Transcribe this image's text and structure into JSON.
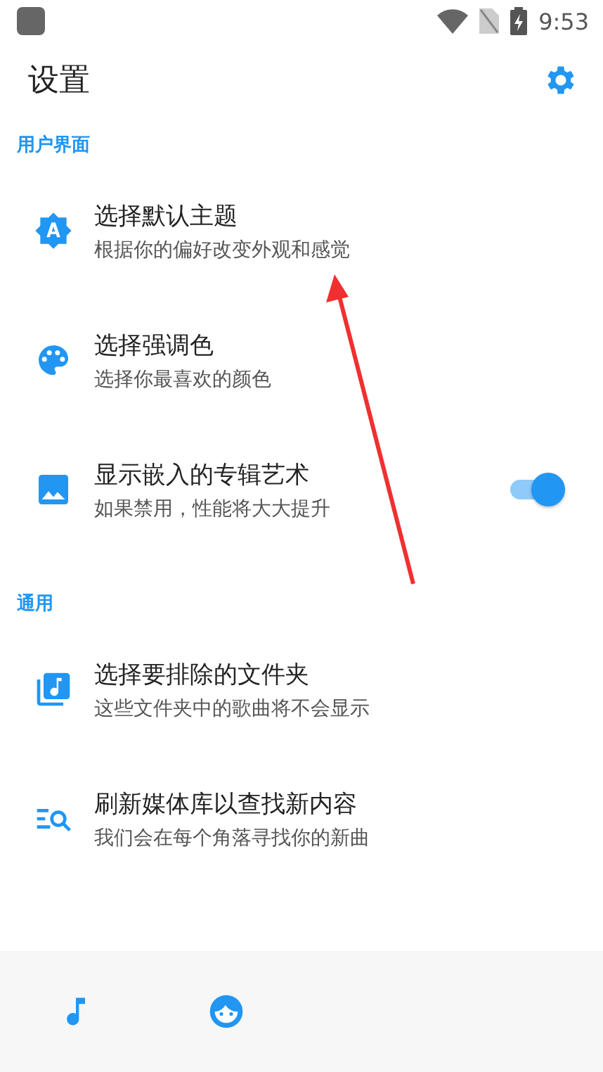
{
  "status_bar": {
    "time": "9:53"
  },
  "header": {
    "title": "设置"
  },
  "sections": [
    {
      "title": "用户界面",
      "items": [
        {
          "kind": "plain",
          "title": "选择默认主题",
          "subtitle": "根据你的偏好改变外观和感觉"
        },
        {
          "kind": "plain",
          "title": "选择强调色",
          "subtitle": "选择你最喜欢的颜色"
        },
        {
          "kind": "toggle",
          "title": "显示嵌入的专辑艺术",
          "subtitle": "如果禁用，性能将大大提升",
          "on": true
        }
      ]
    },
    {
      "title": "通用",
      "items": [
        {
          "kind": "plain",
          "title": "选择要排除的文件夹",
          "subtitle": "这些文件夹中的歌曲将不会显示"
        },
        {
          "kind": "plain",
          "title": "刷新媒体库以查找新内容",
          "subtitle": "我们会在每个角落寻找你的新曲"
        }
      ]
    }
  ]
}
